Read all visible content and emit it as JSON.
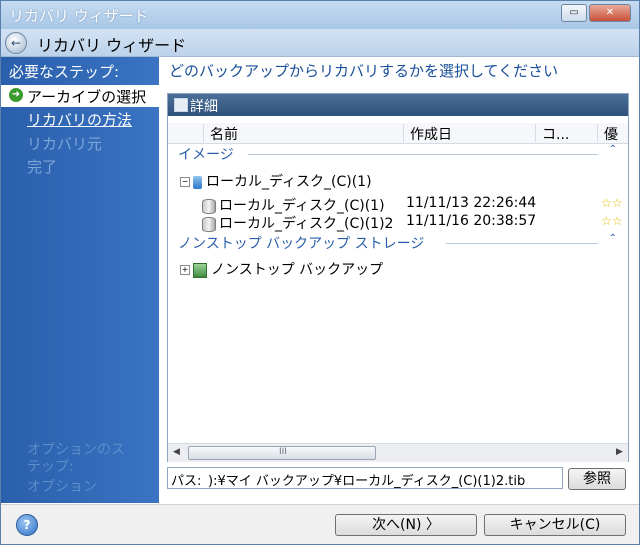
{
  "window": {
    "title": "リカバリ ウィザード",
    "minimize": "▭",
    "close": "✕"
  },
  "header": {
    "title": "リカバリ ウィザード",
    "back_icon": "←"
  },
  "sidebar": {
    "heading": "必要なステップ:",
    "current_step": "アーカイブの選択",
    "current_icon": "➜",
    "steps": [
      {
        "label": "リカバリの方法",
        "state": "active"
      },
      {
        "label": "リカバリ元",
        "state": "dim"
      },
      {
        "label": "完了",
        "state": "dim"
      }
    ],
    "optional": [
      "オプションのス",
      "テップ:",
      "オプション"
    ]
  },
  "main": {
    "prompt": "どのバックアップからリカバリするかを選択してください",
    "panel_title": "詳細",
    "columns": [
      "名前",
      "作成日",
      "コ...",
      "優"
    ],
    "groups": [
      {
        "label": "イメージ",
        "caret": "⌃"
      },
      {
        "label": "ノンストップ バックアップ ストレージ",
        "caret": "⌃"
      }
    ],
    "tree": {
      "disk": {
        "expander": "−",
        "name": "ローカル_ディスク_(C)(1)"
      },
      "backups": [
        {
          "name": "ローカル_ディスク_(C)(1)",
          "date": "11/11/13 22:26:44",
          "stars": "☆☆"
        },
        {
          "name": "ローカル_ディスク_(C)(1)2",
          "date": "11/11/16 20:38:57",
          "stars": "☆☆"
        }
      ],
      "nonstop": {
        "expander": "+",
        "name": "ノンストップ バックアップ"
      }
    },
    "scroll": {
      "left": "◀",
      "right": "▶",
      "grip": "III"
    }
  },
  "path": {
    "label": "パス:",
    "value": "):¥マイ バックアップ¥ローカル_ディスク_(C)(1)2.tib",
    "browse": "参照"
  },
  "footer": {
    "help": "?",
    "next": "次へ(N) 〉",
    "cancel": "キャンセル(C)"
  },
  "colors": {
    "sidebar": "#2a5fab",
    "accent": "#1a4f9a",
    "panel_header": "#2f527b"
  }
}
